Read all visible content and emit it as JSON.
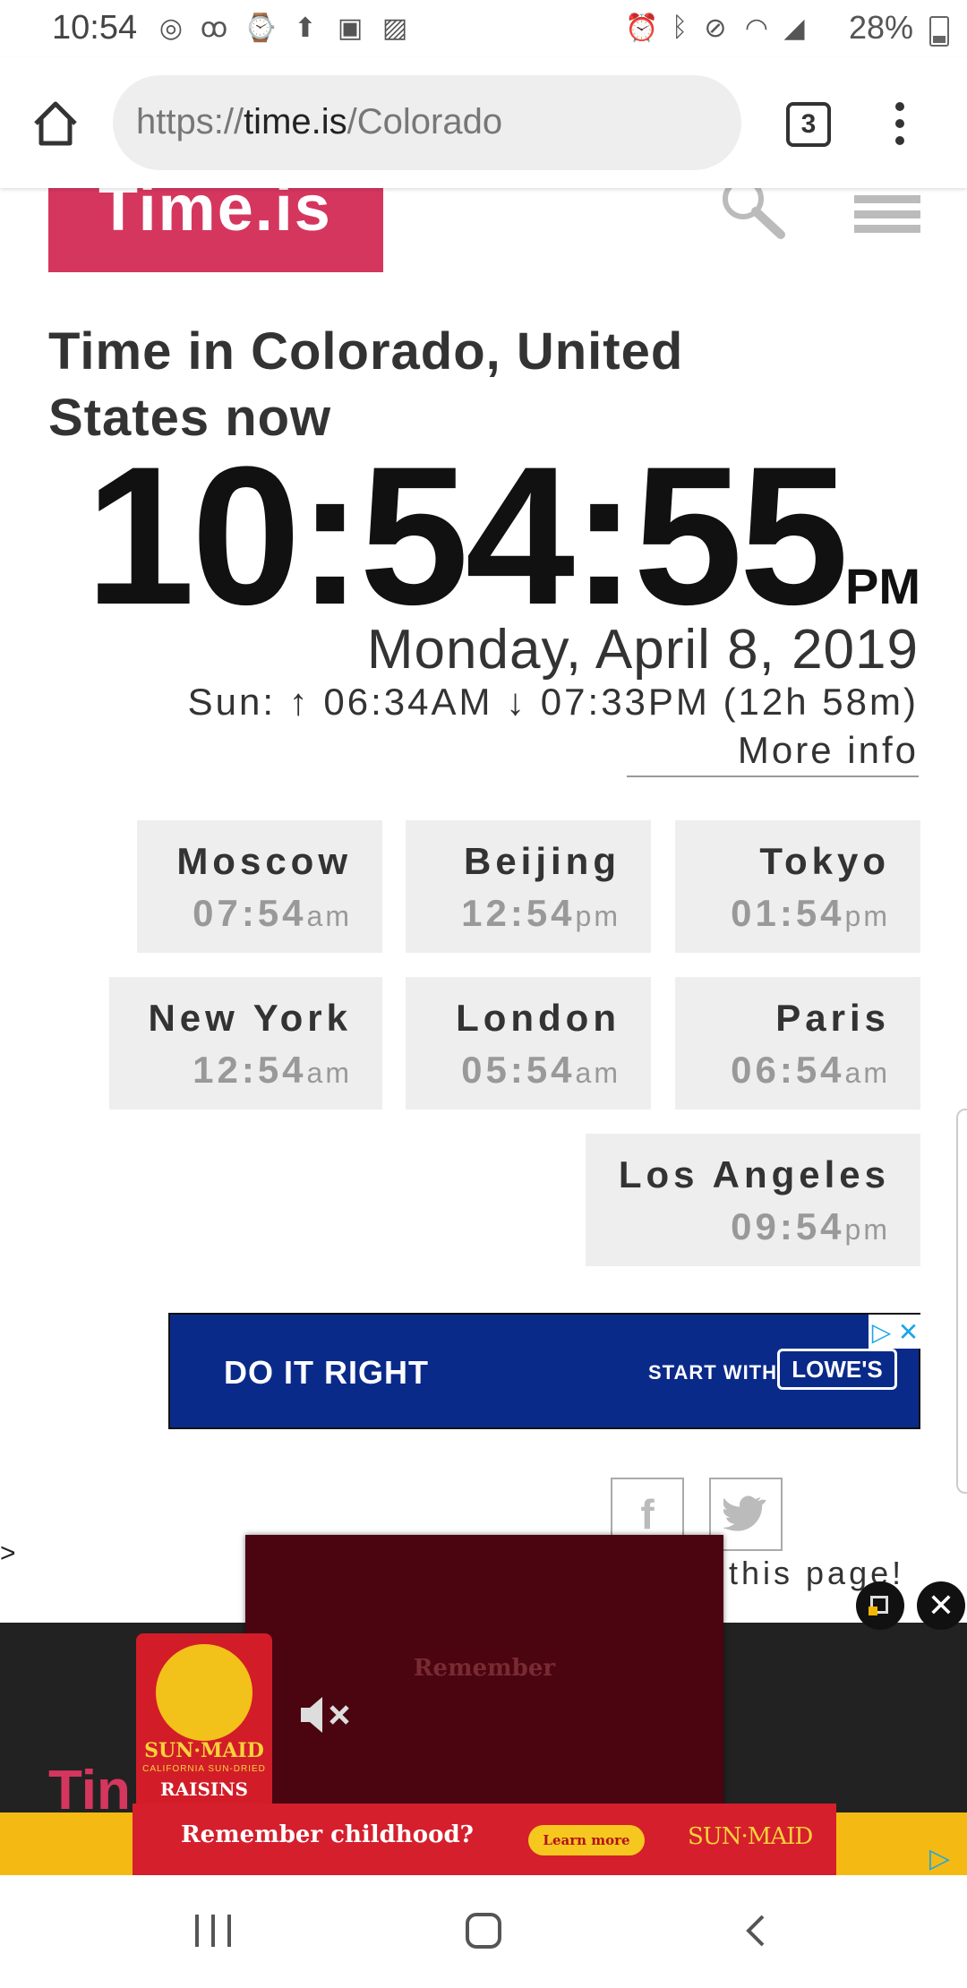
{
  "status_bar": {
    "time": "10:54",
    "battery": "28%",
    "icons": [
      "account-circle-icon",
      "voicemail-icon",
      "watch-icon",
      "upload-icon",
      "messaging-icon",
      "gallery-icon",
      "alarm-icon",
      "bluetooth-icon",
      "vibrate-mute-icon",
      "wifi-icon",
      "signal-icon",
      "battery-icon"
    ]
  },
  "browser": {
    "url_scheme": "https://",
    "url_host": "time.is",
    "url_path": "/Colorado",
    "tab_count": "3"
  },
  "site": {
    "logo": "Time.is",
    "headline": "Time in Colorado, United States now",
    "clock": "10:54:55",
    "ampm": "PM",
    "date": "Monday, April 8, 2019",
    "sun": "Sun: ↑ 06:34AM ↓ 07:33PM (12h 58m)",
    "more_info": "More info"
  },
  "cities": [
    {
      "name": "Moscow",
      "time": "07:54",
      "ampm": "am"
    },
    {
      "name": "Beijing",
      "time": "12:54",
      "ampm": "pm"
    },
    {
      "name": "Tokyo",
      "time": "01:54",
      "ampm": "pm"
    },
    {
      "name": "New York",
      "time": "12:54",
      "ampm": "am"
    },
    {
      "name": "London",
      "time": "05:54",
      "ampm": "am"
    },
    {
      "name": "Paris",
      "time": "06:54",
      "ampm": "am"
    },
    {
      "name": "Los Angeles",
      "time": "09:54",
      "ampm": "pm"
    }
  ],
  "lowes_ad": {
    "left_text": "DO IT RIGHT",
    "right_text": "START WITH",
    "logo": "LOWE'S",
    "choices_icon": "▷",
    "close_icon": "✕"
  },
  "social": {
    "facebook": "f",
    "share_text": "this page!",
    "side_marker": ">"
  },
  "video_ad": {
    "partial_logo": "Tin",
    "video_caption": "Remember",
    "product_brand": "SUN·MAID",
    "product_sub": "CALIFORNIA SUN-DRIED",
    "product_name": "RAISINS",
    "banner_text": "Remember childhood?",
    "banner_button": "Learn more",
    "banner_brand": "SUN·MAID",
    "close_icon": "✕",
    "colors": {
      "banner_red": "#d61f2c",
      "banner_yellow": "#f4b912",
      "video_bg": "#4a0510"
    }
  },
  "colors": {
    "brand": "#d5365e",
    "tile_bg": "#eeeeee",
    "lowes_blue": "#0a2a8a"
  }
}
